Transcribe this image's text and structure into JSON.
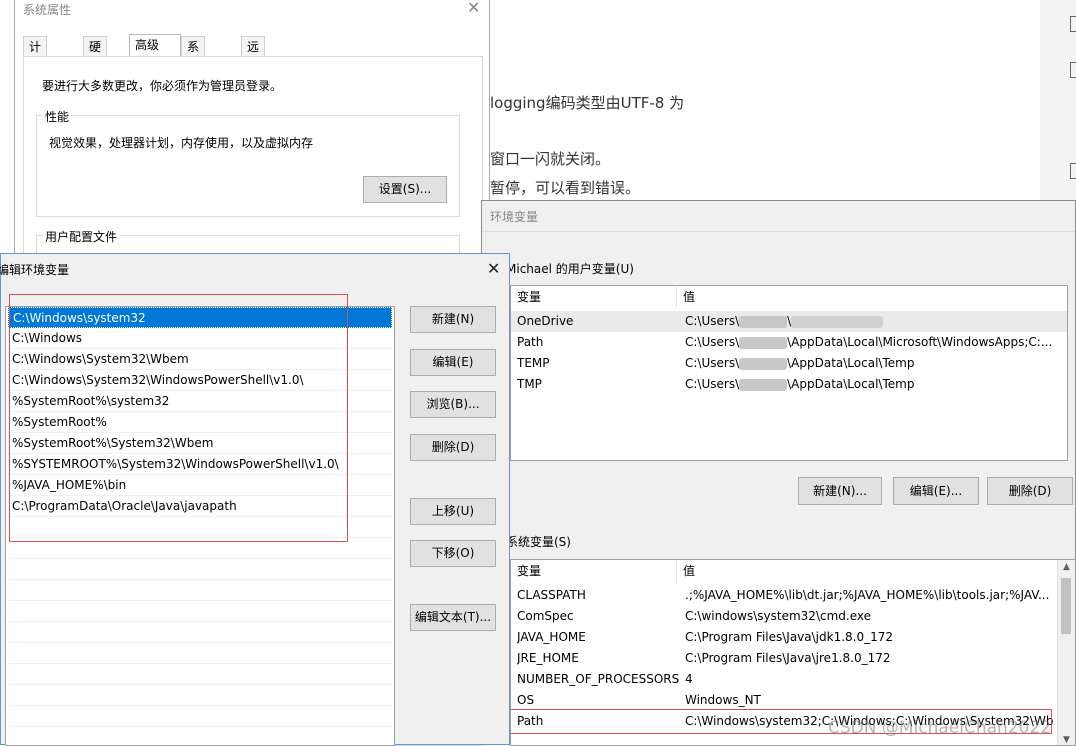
{
  "article": {
    "lines": [
      "logging编码类型由UTF-8 为",
      "窗口一闪就关闭。",
      "暂停，可以看到错误。"
    ]
  },
  "system_properties": {
    "title": "系统属性",
    "tabs": [
      {
        "label": "计算机名"
      },
      {
        "label": "硬件"
      },
      {
        "label": "高级"
      },
      {
        "label": "系统保护"
      },
      {
        "label": "远程"
      }
    ],
    "admin_note": "要进行大多数更改，你必须作为管理员登录。",
    "perf_group": "性能",
    "perf_desc": "视觉效果，处理器计划，内存使用，以及虚拟内存",
    "settings_button": "设置(S)...",
    "profile_group": "用户配置文件"
  },
  "edit_env": {
    "title": "编辑环境变量",
    "close": "✕",
    "items": [
      "C:\\Windows\\system32",
      "C:\\Windows",
      "C:\\Windows\\System32\\Wbem",
      "C:\\Windows\\System32\\WindowsPowerShell\\v1.0\\",
      "%SystemRoot%\\system32",
      "%SystemRoot%",
      "%SystemRoot%\\System32\\Wbem",
      "%SYSTEMROOT%\\System32\\WindowsPowerShell\\v1.0\\",
      "%JAVA_HOME%\\bin",
      "C:\\ProgramData\\Oracle\\Java\\javapath"
    ],
    "buttons": {
      "new": "新建(N)",
      "edit": "编辑(E)",
      "browse": "浏览(B)...",
      "delete": "删除(D)",
      "move_up": "上移(U)",
      "move_down": "下移(O)",
      "edit_text": "编辑文本(T)..."
    }
  },
  "env_vars": {
    "title": "环境变量",
    "user_group": "Michael 的用户变量(U)",
    "col_var": "变量",
    "col_val": "值",
    "user_vars": [
      {
        "name": "OneDrive",
        "pre": "C:\\Users\\",
        "post": "\\"
      },
      {
        "name": "Path",
        "pre": "C:\\Users\\",
        "post": "\\AppData\\Local\\Microsoft\\WindowsApps;C:..."
      },
      {
        "name": "TEMP",
        "pre": "C:\\Users\\",
        "post": "\\AppData\\Local\\Temp"
      },
      {
        "name": "TMP",
        "pre": "C:\\Users\\",
        "post": "\\AppData\\Local\\Temp"
      }
    ],
    "user_buttons": {
      "new": "新建(N)...",
      "edit": "编辑(E)...",
      "delete": "删除(D)"
    },
    "system_group": "系统变量(S)",
    "system_vars": [
      {
        "name": "CLASSPATH",
        "value": ".;%JAVA_HOME%\\lib\\dt.jar;%JAVA_HOME%\\lib\\tools.jar;%JAV..."
      },
      {
        "name": "ComSpec",
        "value": "C:\\windows\\system32\\cmd.exe"
      },
      {
        "name": "JAVA_HOME",
        "value": "C:\\Program Files\\Java\\jdk1.8.0_172"
      },
      {
        "name": "JRE_HOME",
        "value": "C:\\Program Files\\Java\\jre1.8.0_172"
      },
      {
        "name": "NUMBER_OF_PROCESSORS",
        "value": "4"
      },
      {
        "name": "OS",
        "value": "Windows_NT"
      },
      {
        "name": "Path",
        "value": "C:\\Windows\\system32;C:\\Windows;C:\\Windows\\System32\\Wb..."
      }
    ]
  },
  "watermark": "CSDN @MichaelChan2022"
}
